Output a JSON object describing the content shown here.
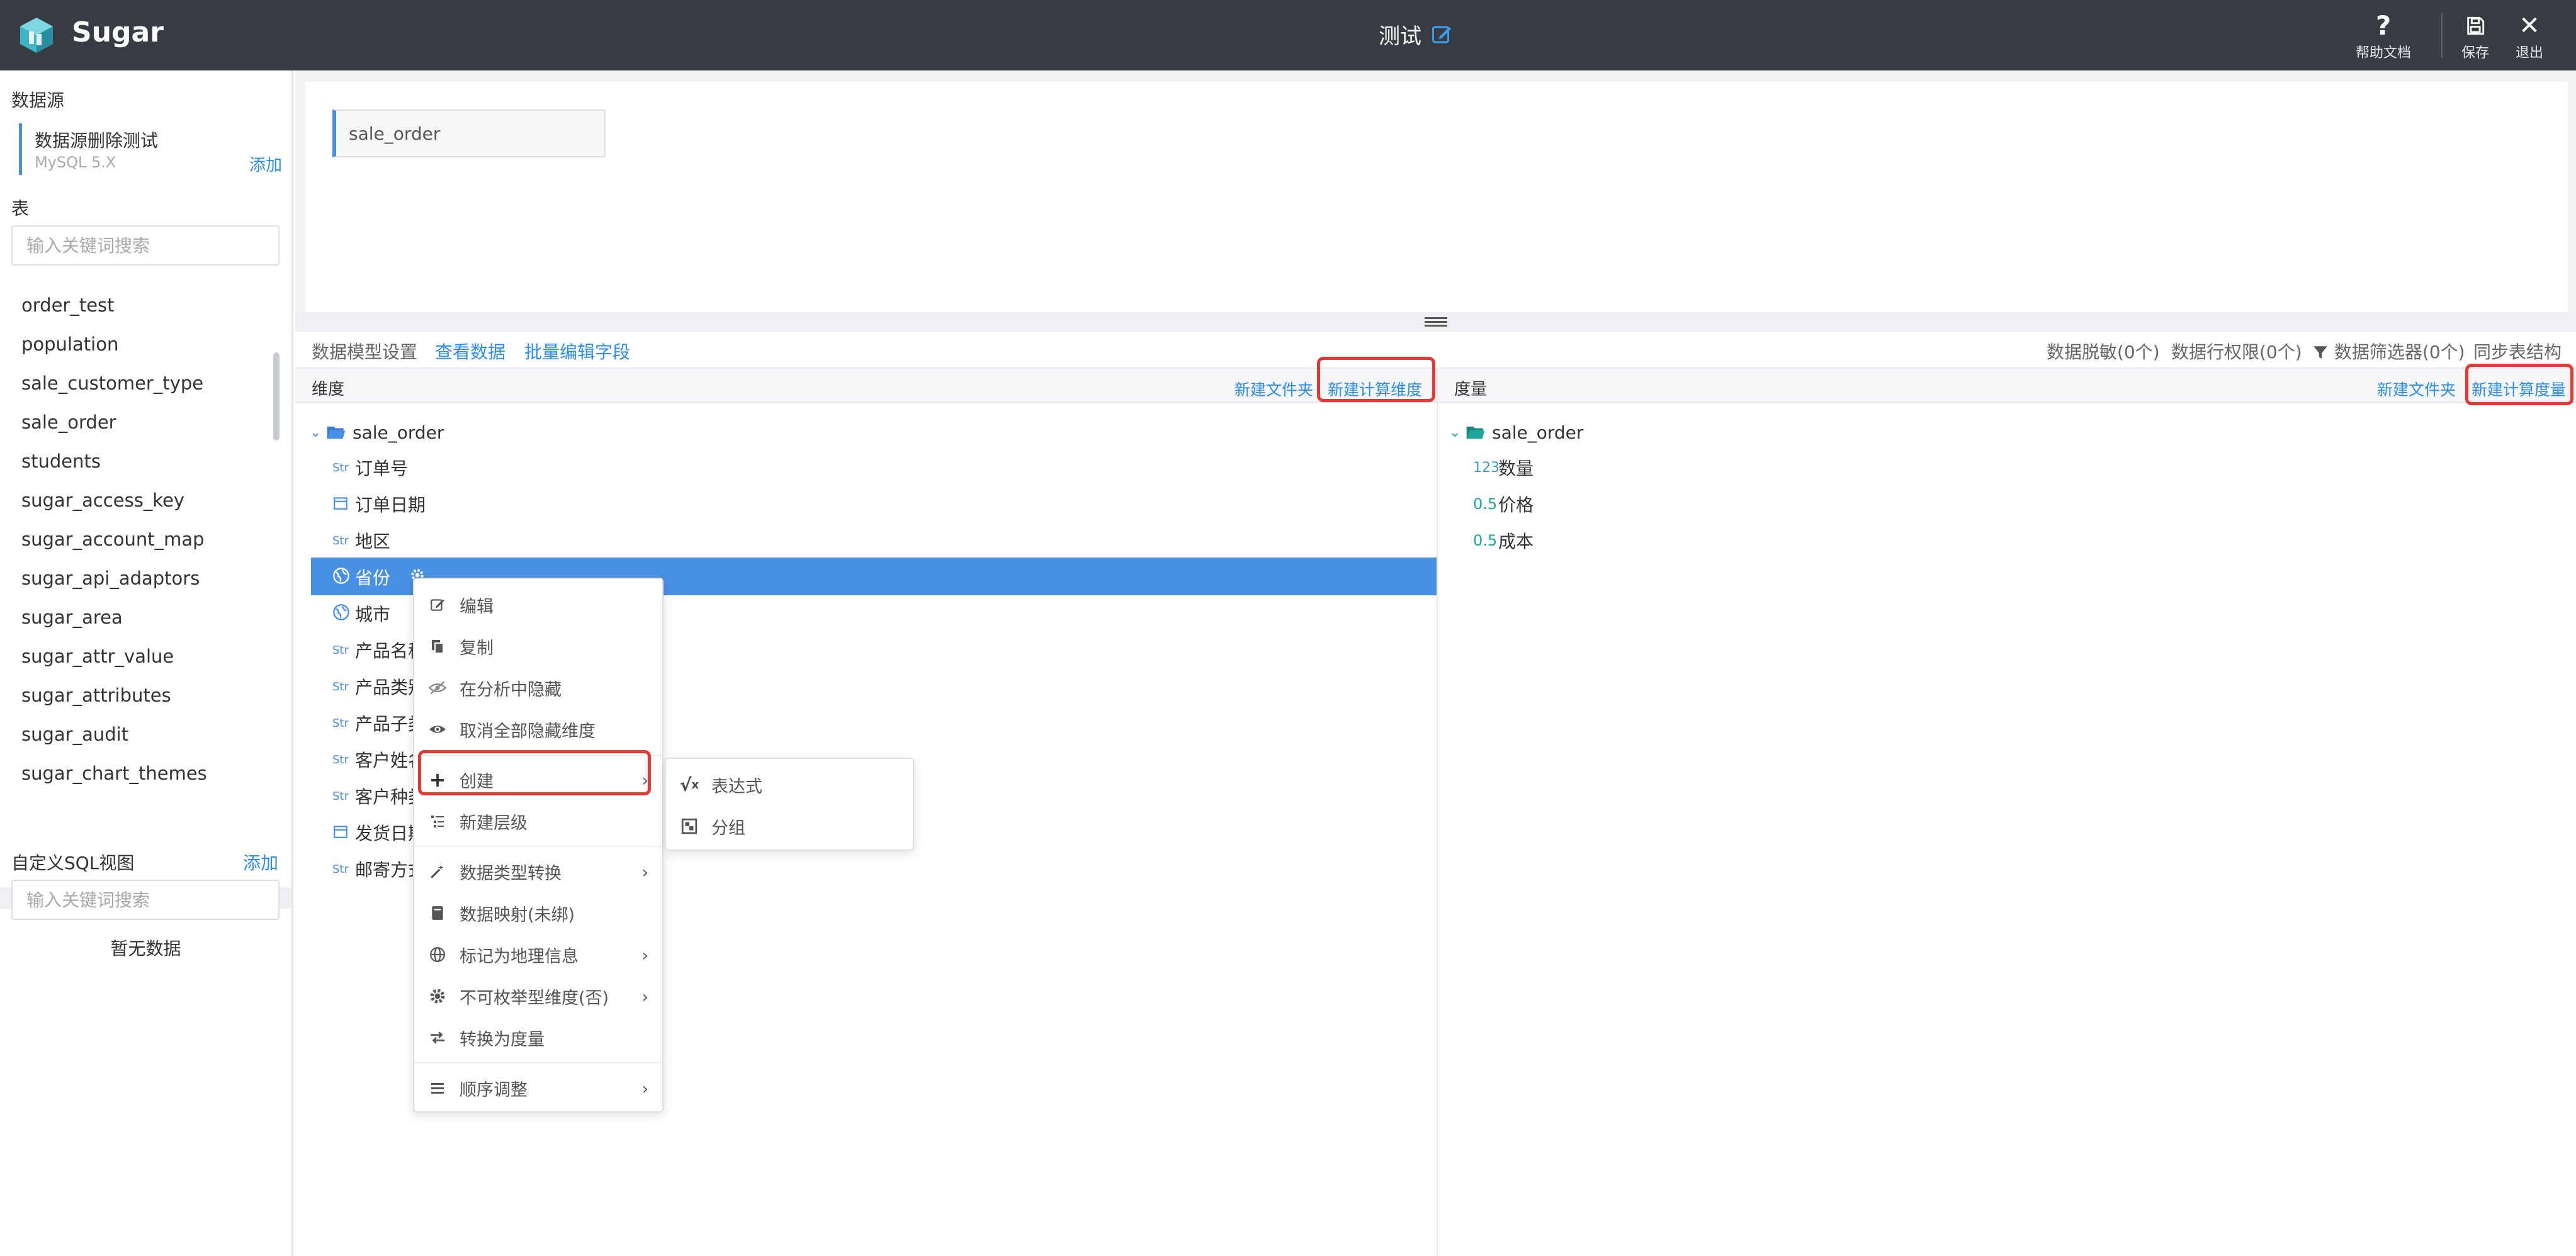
{
  "header": {
    "brand": "Sugar",
    "title": "测试",
    "help_label": "帮助文档",
    "save_label": "保存",
    "exit_label": "退出"
  },
  "sidebar": {
    "datasource_title": "数据源",
    "datasource": {
      "name": "数据源删除测试",
      "type": "MySQL 5.X",
      "add_label": "添加"
    },
    "tables_title": "表",
    "table_search_placeholder": "输入关键词搜索",
    "tables": [
      "order_test",
      "population",
      "sale_customer_type",
      "sale_order",
      "students",
      "sugar_access_key",
      "sugar_account_map",
      "sugar_api_adaptors",
      "sugar_area",
      "sugar_attr_value",
      "sugar_attributes",
      "sugar_audit",
      "sugar_chart_themes"
    ],
    "sql_title": "自定义SQL视图",
    "sql_add_label": "添加",
    "sql_search_placeholder": "输入关键词搜索",
    "sql_empty": "暂无数据"
  },
  "main": {
    "selected_table": "sale_order",
    "toolbar": {
      "model_settings": "数据模型设置",
      "view_data": "查看数据",
      "batch_edit": "批量编辑字段",
      "masking": "数据脱敏(0个)",
      "row_permission": "数据行权限(0个)",
      "filter": "数据筛选器(0个)",
      "sync": "同步表结构"
    },
    "dimensions": {
      "title": "维度",
      "new_folder": "新建文件夹",
      "new_calc": "新建计算维度",
      "folder": "sale_order",
      "fields": [
        {
          "tag": "Str",
          "name": "订单号",
          "icon": "string"
        },
        {
          "tag": "",
          "name": "订单日期",
          "icon": "calendar"
        },
        {
          "tag": "Str",
          "name": "地区",
          "icon": "string"
        },
        {
          "tag": "",
          "name": "省份",
          "icon": "globe"
        },
        {
          "tag": "",
          "name": "城市",
          "icon": "globe"
        },
        {
          "tag": "Str",
          "name": "产品名称",
          "icon": "string"
        },
        {
          "tag": "Str",
          "name": "产品类别",
          "icon": "string"
        },
        {
          "tag": "Str",
          "name": "产品子类",
          "icon": "string"
        },
        {
          "tag": "Str",
          "name": "客户姓名",
          "icon": "string"
        },
        {
          "tag": "Str",
          "name": "客户种类",
          "icon": "string"
        },
        {
          "tag": "",
          "name": "发货日期",
          "icon": "calendar"
        },
        {
          "tag": "Str",
          "name": "邮寄方式",
          "icon": "string"
        }
      ]
    },
    "measures": {
      "title": "度量",
      "new_folder": "新建文件夹",
      "new_calc": "新建计算度量",
      "folder": "sale_order",
      "fields": [
        {
          "tag": "123",
          "name": "数量"
        },
        {
          "tag": "0.5",
          "name": "价格"
        },
        {
          "tag": "0.5",
          "name": "成本"
        }
      ]
    }
  },
  "context_menu": {
    "items": [
      {
        "label": "编辑",
        "icon": "edit-icon"
      },
      {
        "label": "复制",
        "icon": "copy-icon"
      },
      {
        "label": "在分析中隐藏",
        "icon": "eye-slash-icon"
      },
      {
        "label": "取消全部隐藏维度",
        "icon": "eye-icon"
      },
      {
        "label": "创建",
        "icon": "plus-icon"
      },
      {
        "label": "新建层级",
        "icon": "hierarchy-icon"
      },
      {
        "label": "数据类型转换",
        "icon": "magic-icon"
      },
      {
        "label": "数据映射(未绑)",
        "icon": "book-icon"
      },
      {
        "label": "标记为地理信息",
        "icon": "globe-icon"
      },
      {
        "label": "不可枚举型维度(否)",
        "icon": "gear-icon"
      },
      {
        "label": "转换为度量",
        "icon": "exchange-icon"
      },
      {
        "label": "顺序调整",
        "icon": "list-icon"
      }
    ],
    "submenu": [
      {
        "label": "表达式",
        "icon": "sqrt-icon"
      },
      {
        "label": "分组",
        "icon": "group-icon"
      }
    ]
  },
  "colors": {
    "header_bg": "#373c43",
    "accent": "#4a90e2",
    "link": "#2d8cf0",
    "highlight_box": "#e53935"
  }
}
